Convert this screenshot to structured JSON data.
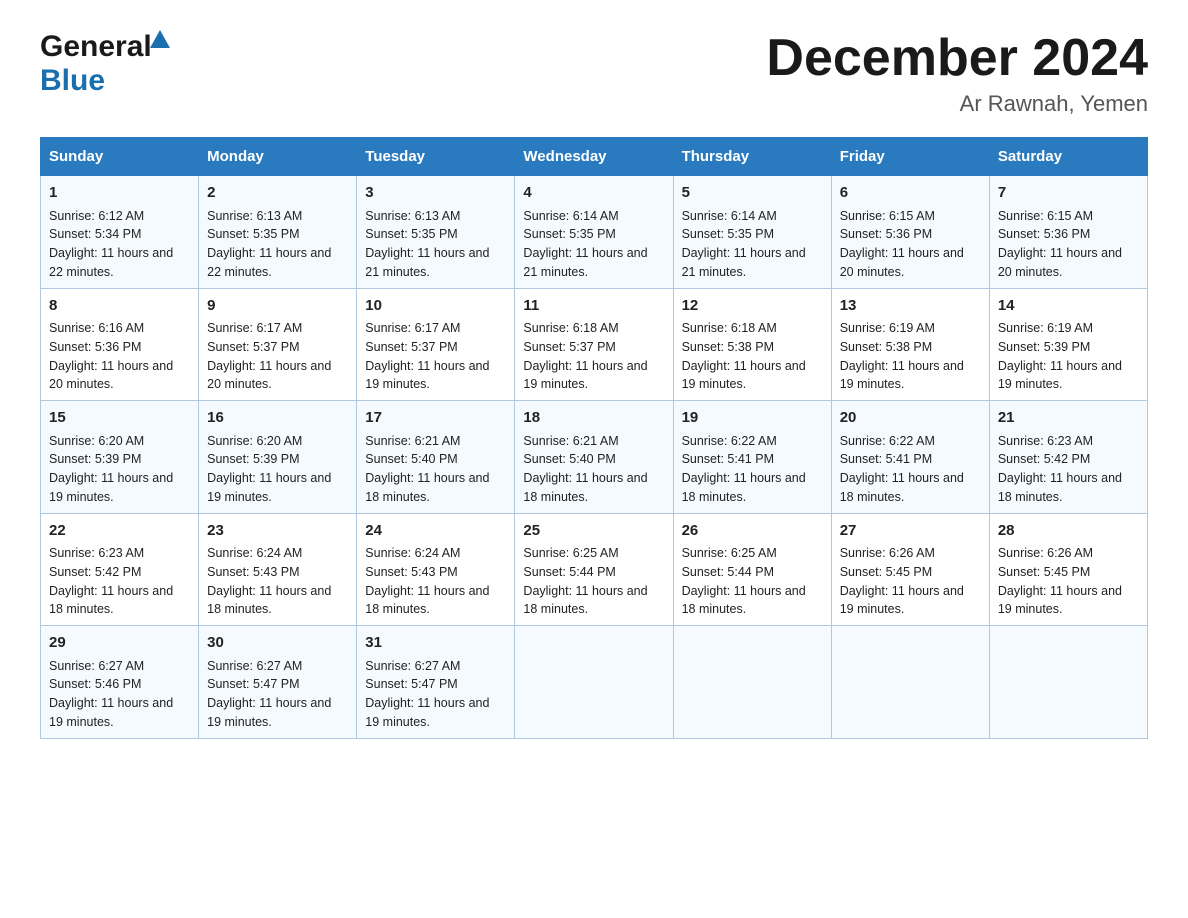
{
  "logo": {
    "general": "General",
    "blue": "Blue",
    "triangle_color": "#1a6faf"
  },
  "title": {
    "month_year": "December 2024",
    "location": "Ar Rawnah, Yemen"
  },
  "days_header": [
    "Sunday",
    "Monday",
    "Tuesday",
    "Wednesday",
    "Thursday",
    "Friday",
    "Saturday"
  ],
  "weeks": [
    [
      {
        "day": "1",
        "sunrise": "Sunrise: 6:12 AM",
        "sunset": "Sunset: 5:34 PM",
        "daylight": "Daylight: 11 hours and 22 minutes."
      },
      {
        "day": "2",
        "sunrise": "Sunrise: 6:13 AM",
        "sunset": "Sunset: 5:35 PM",
        "daylight": "Daylight: 11 hours and 22 minutes."
      },
      {
        "day": "3",
        "sunrise": "Sunrise: 6:13 AM",
        "sunset": "Sunset: 5:35 PM",
        "daylight": "Daylight: 11 hours and 21 minutes."
      },
      {
        "day": "4",
        "sunrise": "Sunrise: 6:14 AM",
        "sunset": "Sunset: 5:35 PM",
        "daylight": "Daylight: 11 hours and 21 minutes."
      },
      {
        "day": "5",
        "sunrise": "Sunrise: 6:14 AM",
        "sunset": "Sunset: 5:35 PM",
        "daylight": "Daylight: 11 hours and 21 minutes."
      },
      {
        "day": "6",
        "sunrise": "Sunrise: 6:15 AM",
        "sunset": "Sunset: 5:36 PM",
        "daylight": "Daylight: 11 hours and 20 minutes."
      },
      {
        "day": "7",
        "sunrise": "Sunrise: 6:15 AM",
        "sunset": "Sunset: 5:36 PM",
        "daylight": "Daylight: 11 hours and 20 minutes."
      }
    ],
    [
      {
        "day": "8",
        "sunrise": "Sunrise: 6:16 AM",
        "sunset": "Sunset: 5:36 PM",
        "daylight": "Daylight: 11 hours and 20 minutes."
      },
      {
        "day": "9",
        "sunrise": "Sunrise: 6:17 AM",
        "sunset": "Sunset: 5:37 PM",
        "daylight": "Daylight: 11 hours and 20 minutes."
      },
      {
        "day": "10",
        "sunrise": "Sunrise: 6:17 AM",
        "sunset": "Sunset: 5:37 PM",
        "daylight": "Daylight: 11 hours and 19 minutes."
      },
      {
        "day": "11",
        "sunrise": "Sunrise: 6:18 AM",
        "sunset": "Sunset: 5:37 PM",
        "daylight": "Daylight: 11 hours and 19 minutes."
      },
      {
        "day": "12",
        "sunrise": "Sunrise: 6:18 AM",
        "sunset": "Sunset: 5:38 PM",
        "daylight": "Daylight: 11 hours and 19 minutes."
      },
      {
        "day": "13",
        "sunrise": "Sunrise: 6:19 AM",
        "sunset": "Sunset: 5:38 PM",
        "daylight": "Daylight: 11 hours and 19 minutes."
      },
      {
        "day": "14",
        "sunrise": "Sunrise: 6:19 AM",
        "sunset": "Sunset: 5:39 PM",
        "daylight": "Daylight: 11 hours and 19 minutes."
      }
    ],
    [
      {
        "day": "15",
        "sunrise": "Sunrise: 6:20 AM",
        "sunset": "Sunset: 5:39 PM",
        "daylight": "Daylight: 11 hours and 19 minutes."
      },
      {
        "day": "16",
        "sunrise": "Sunrise: 6:20 AM",
        "sunset": "Sunset: 5:39 PM",
        "daylight": "Daylight: 11 hours and 19 minutes."
      },
      {
        "day": "17",
        "sunrise": "Sunrise: 6:21 AM",
        "sunset": "Sunset: 5:40 PM",
        "daylight": "Daylight: 11 hours and 18 minutes."
      },
      {
        "day": "18",
        "sunrise": "Sunrise: 6:21 AM",
        "sunset": "Sunset: 5:40 PM",
        "daylight": "Daylight: 11 hours and 18 minutes."
      },
      {
        "day": "19",
        "sunrise": "Sunrise: 6:22 AM",
        "sunset": "Sunset: 5:41 PM",
        "daylight": "Daylight: 11 hours and 18 minutes."
      },
      {
        "day": "20",
        "sunrise": "Sunrise: 6:22 AM",
        "sunset": "Sunset: 5:41 PM",
        "daylight": "Daylight: 11 hours and 18 minutes."
      },
      {
        "day": "21",
        "sunrise": "Sunrise: 6:23 AM",
        "sunset": "Sunset: 5:42 PM",
        "daylight": "Daylight: 11 hours and 18 minutes."
      }
    ],
    [
      {
        "day": "22",
        "sunrise": "Sunrise: 6:23 AM",
        "sunset": "Sunset: 5:42 PM",
        "daylight": "Daylight: 11 hours and 18 minutes."
      },
      {
        "day": "23",
        "sunrise": "Sunrise: 6:24 AM",
        "sunset": "Sunset: 5:43 PM",
        "daylight": "Daylight: 11 hours and 18 minutes."
      },
      {
        "day": "24",
        "sunrise": "Sunrise: 6:24 AM",
        "sunset": "Sunset: 5:43 PM",
        "daylight": "Daylight: 11 hours and 18 minutes."
      },
      {
        "day": "25",
        "sunrise": "Sunrise: 6:25 AM",
        "sunset": "Sunset: 5:44 PM",
        "daylight": "Daylight: 11 hours and 18 minutes."
      },
      {
        "day": "26",
        "sunrise": "Sunrise: 6:25 AM",
        "sunset": "Sunset: 5:44 PM",
        "daylight": "Daylight: 11 hours and 18 minutes."
      },
      {
        "day": "27",
        "sunrise": "Sunrise: 6:26 AM",
        "sunset": "Sunset: 5:45 PM",
        "daylight": "Daylight: 11 hours and 19 minutes."
      },
      {
        "day": "28",
        "sunrise": "Sunrise: 6:26 AM",
        "sunset": "Sunset: 5:45 PM",
        "daylight": "Daylight: 11 hours and 19 minutes."
      }
    ],
    [
      {
        "day": "29",
        "sunrise": "Sunrise: 6:27 AM",
        "sunset": "Sunset: 5:46 PM",
        "daylight": "Daylight: 11 hours and 19 minutes."
      },
      {
        "day": "30",
        "sunrise": "Sunrise: 6:27 AM",
        "sunset": "Sunset: 5:47 PM",
        "daylight": "Daylight: 11 hours and 19 minutes."
      },
      {
        "day": "31",
        "sunrise": "Sunrise: 6:27 AM",
        "sunset": "Sunset: 5:47 PM",
        "daylight": "Daylight: 11 hours and 19 minutes."
      },
      {
        "day": "",
        "sunrise": "",
        "sunset": "",
        "daylight": ""
      },
      {
        "day": "",
        "sunrise": "",
        "sunset": "",
        "daylight": ""
      },
      {
        "day": "",
        "sunrise": "",
        "sunset": "",
        "daylight": ""
      },
      {
        "day": "",
        "sunrise": "",
        "sunset": "",
        "daylight": ""
      }
    ]
  ]
}
